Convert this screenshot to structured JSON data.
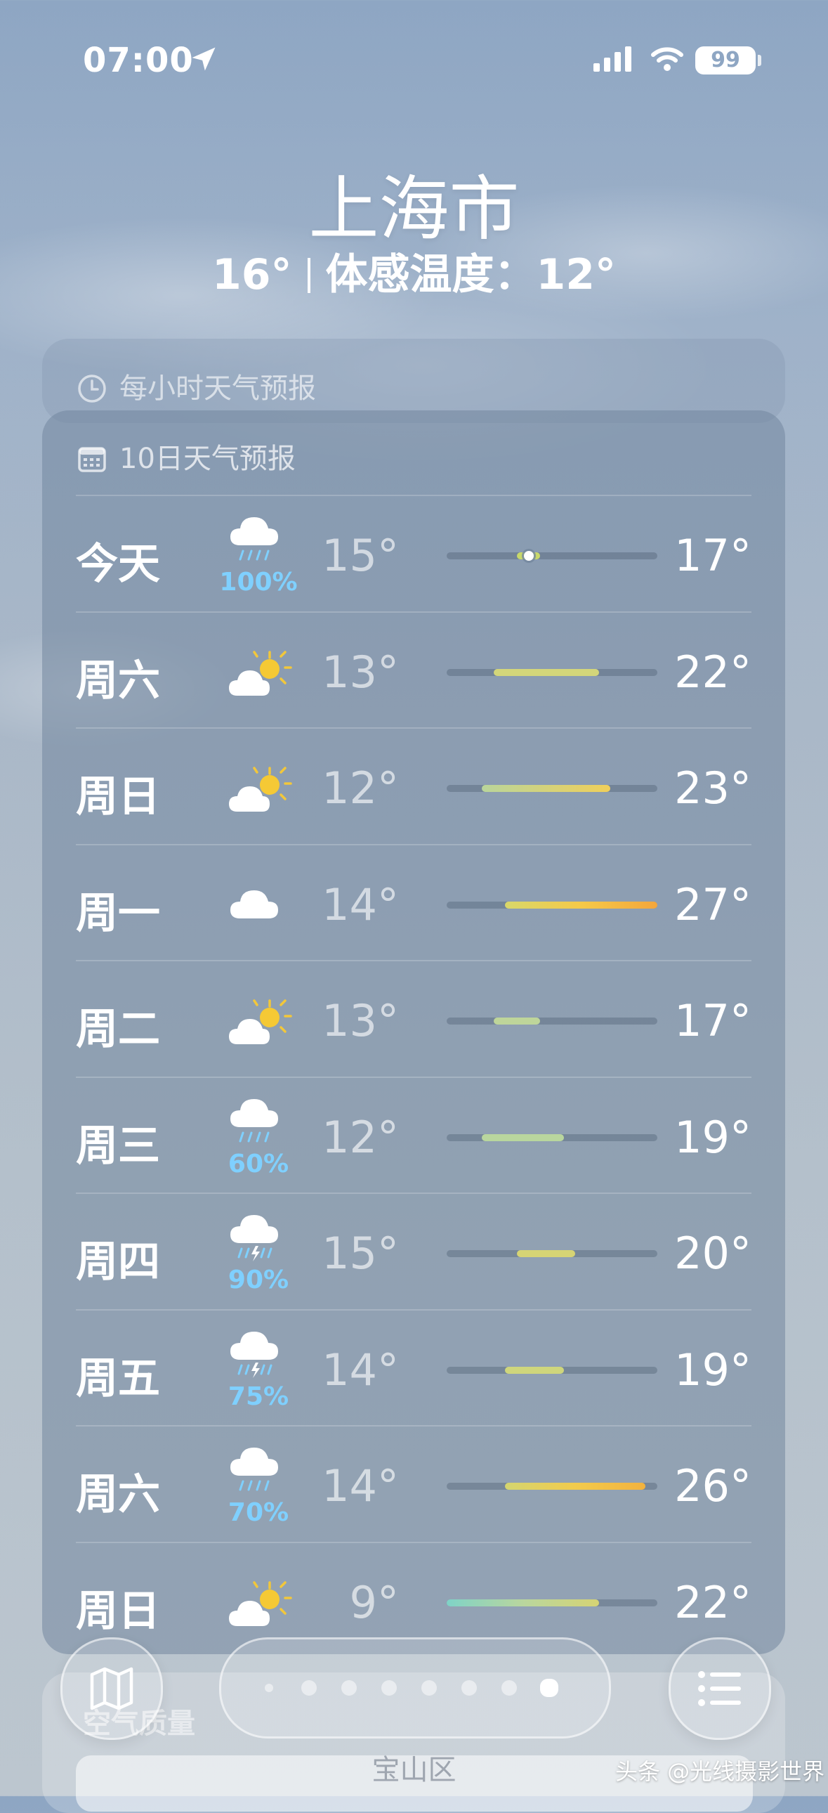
{
  "status_bar": {
    "time": "07:00",
    "battery": "99"
  },
  "header": {
    "city": "上海市",
    "temp": "16°",
    "feels_like": "体感温度：12°"
  },
  "hourly_card": {
    "title": "每小时天气预报"
  },
  "ten_day": {
    "title": "10日天气预报",
    "scale_min": 9,
    "scale_max": 27,
    "rows": [
      {
        "day": "今天",
        "icon": "rain-cloud-icon",
        "precip": "100%",
        "low": "15°",
        "high": "17°",
        "lo_val": 15,
        "hi_val": 17,
        "current": 16,
        "color": "#c8d86a"
      },
      {
        "day": "周六",
        "icon": "partly-sunny-icon",
        "precip": "",
        "low": "13°",
        "high": "22°",
        "lo_val": 13,
        "hi_val": 22,
        "color": "#d3d67a"
      },
      {
        "day": "周日",
        "icon": "partly-sunny-icon",
        "precip": "",
        "low": "12°",
        "high": "23°",
        "lo_val": 12,
        "hi_val": 23,
        "color": "linear-gradient(90deg,#b9d59b,#f0cf5a)"
      },
      {
        "day": "周一",
        "icon": "cloud-icon",
        "precip": "",
        "low": "14°",
        "high": "27°",
        "lo_val": 14,
        "hi_val": 27,
        "color": "linear-gradient(90deg,#d8d76a,#f5c948,#f4a63c)"
      },
      {
        "day": "周二",
        "icon": "partly-sunny-icon",
        "precip": "",
        "low": "13°",
        "high": "17°",
        "lo_val": 13,
        "hi_val": 17,
        "color": "#bed59a"
      },
      {
        "day": "周三",
        "icon": "rain-cloud-icon",
        "precip": "60%",
        "low": "12°",
        "high": "19°",
        "lo_val": 12,
        "hi_val": 19,
        "color": "#b9d69e"
      },
      {
        "day": "周四",
        "icon": "thunderstorm-icon",
        "precip": "90%",
        "low": "15°",
        "high": "20°",
        "lo_val": 15,
        "hi_val": 20,
        "color": "#d6d474"
      },
      {
        "day": "周五",
        "icon": "thunderstorm-icon",
        "precip": "75%",
        "low": "14°",
        "high": "19°",
        "lo_val": 14,
        "hi_val": 19,
        "color": "#cfd67c"
      },
      {
        "day": "周六",
        "icon": "rain-cloud-icon",
        "precip": "70%",
        "low": "14°",
        "high": "26°",
        "lo_val": 14,
        "hi_val": 26,
        "color": "linear-gradient(90deg,#d4d570,#f2cb4c,#f2b23e)"
      },
      {
        "day": "周日",
        "icon": "partly-sunny-icon",
        "precip": "",
        "low": "9°",
        "high": "22°",
        "lo_val": 9,
        "hi_val": 22,
        "color": "linear-gradient(90deg,#7fd3c7,#b9d69e,#d6d474)"
      }
    ]
  },
  "air_quality": {
    "title": "空气质量",
    "district": "宝山区"
  },
  "pager": {
    "count": 8,
    "active_index": 7
  },
  "watermark": "头条 @光线摄影世界"
}
